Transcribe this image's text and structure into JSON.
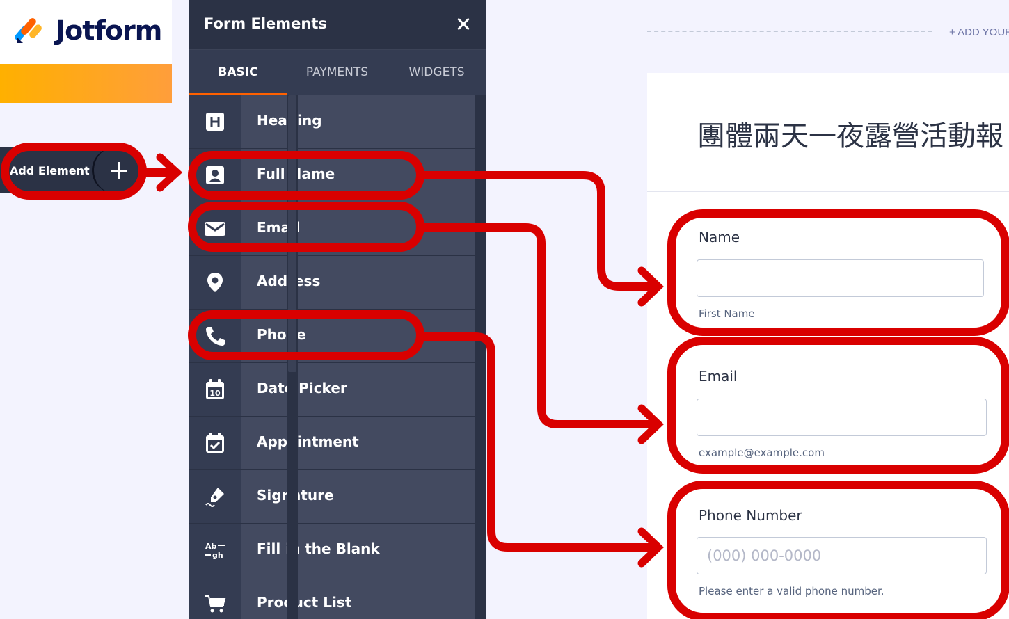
{
  "brand": {
    "name": "Jotform",
    "orange": "#ff6100",
    "navy": "#0a1551"
  },
  "sidebar": {
    "add_element_label": "Add Element",
    "add_icon": "plus-icon"
  },
  "panel": {
    "title": "Form Elements",
    "close_icon": "close-icon",
    "tabs": [
      {
        "label": "BASIC",
        "active": true
      },
      {
        "label": "PAYMENTS",
        "active": false
      },
      {
        "label": "WIDGETS",
        "active": false
      }
    ],
    "items": [
      {
        "label": "Heading",
        "icon": "heading-icon"
      },
      {
        "label": "Full Name",
        "icon": "contact-card-icon"
      },
      {
        "label": "Email",
        "icon": "envelope-icon"
      },
      {
        "label": "Address",
        "icon": "map-pin-icon"
      },
      {
        "label": "Phone",
        "icon": "phone-icon"
      },
      {
        "label": "Date Picker",
        "icon": "calendar-icon"
      },
      {
        "label": "Appointment",
        "icon": "calendar-check-icon"
      },
      {
        "label": "Signature",
        "icon": "pen-icon"
      },
      {
        "label": "Fill in the Blank",
        "icon": "fill-blank-icon"
      },
      {
        "label": "Product List",
        "icon": "cart-icon"
      }
    ]
  },
  "canvas": {
    "add_your_text": "+ ADD YOUR",
    "form_title": "團體兩天一夜露營活動報",
    "fields": [
      {
        "label": "Name",
        "value": "",
        "placeholder": "",
        "sublabel": "First Name"
      },
      {
        "label": "Email",
        "value": "",
        "placeholder": "",
        "sublabel": "example@example.com"
      },
      {
        "label": "Phone Number",
        "value": "",
        "placeholder": "(000) 000-0000",
        "sublabel": "Please enter a valid phone number."
      }
    ]
  },
  "annotation_color": "#d90000"
}
